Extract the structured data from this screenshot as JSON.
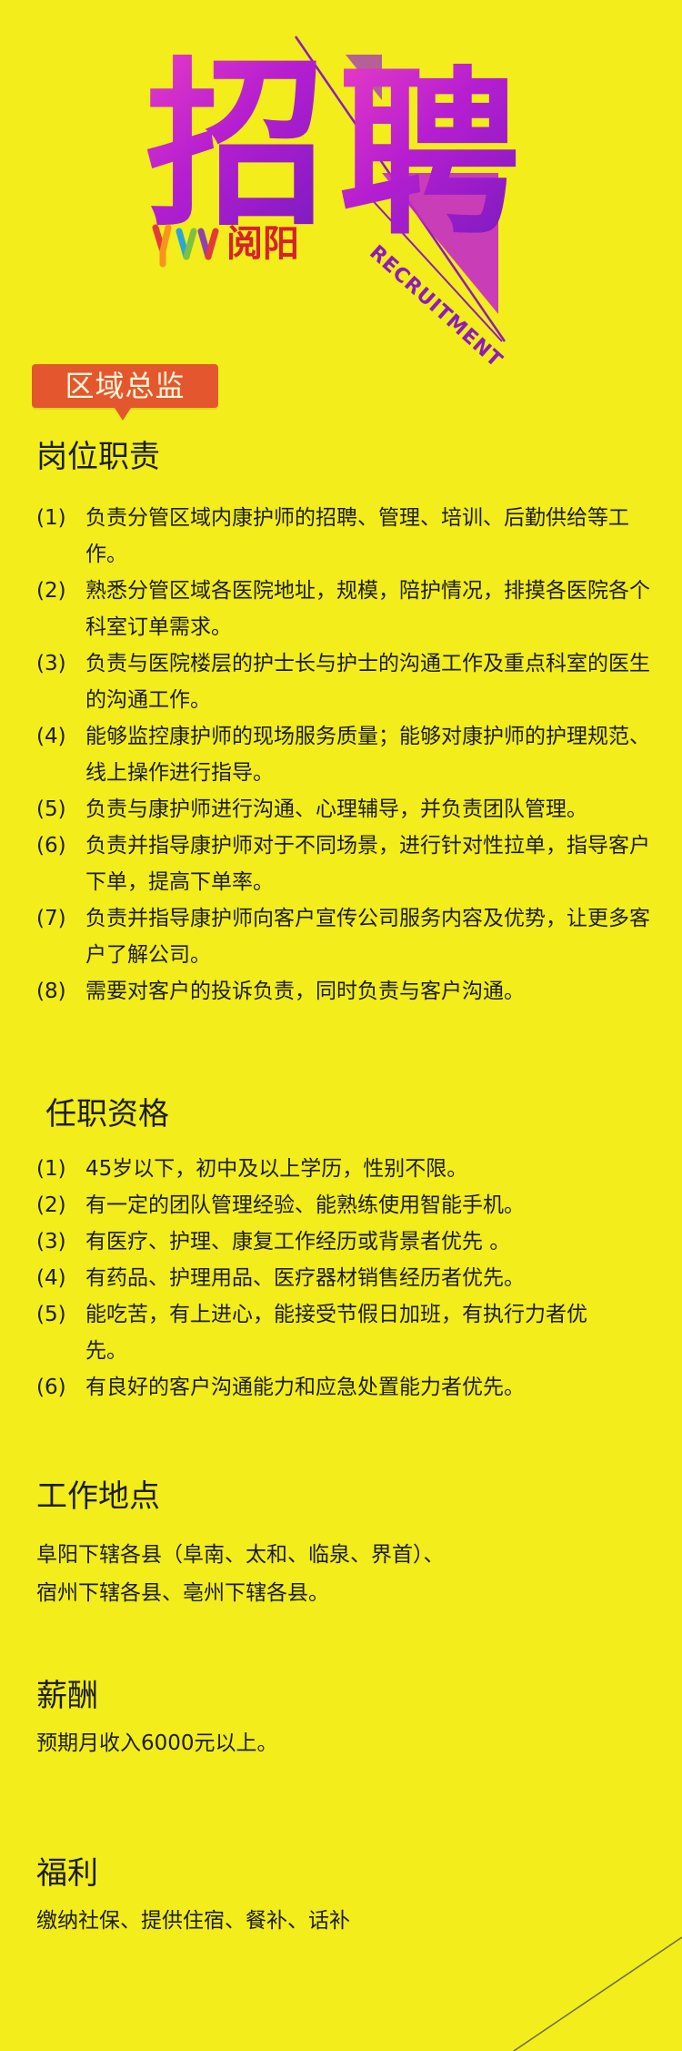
{
  "header": {
    "title_char_1": "招",
    "title_char_2": "聘",
    "recruitment_text": "RECRUITMENT",
    "logo_text": "阅阳",
    "logo_colors": [
      "#e53a3a",
      "#f7941e",
      "#2aa7d8",
      "#7cc242",
      "#8e44ad"
    ]
  },
  "badge": {
    "label": "区域总监",
    "color": "#e4572e"
  },
  "responsibilities": {
    "heading": "岗位职责",
    "items": [
      {
        "num": "(1)",
        "text": "负责分管区域内康护师的招聘、管理、培训、后勤供给等工作。"
      },
      {
        "num": "(2)",
        "text": "熟悉分管区域各医院地址，规模，陪护情况，排摸各医院各个科室订单需求。"
      },
      {
        "num": "(3)",
        "text": "负责与医院楼层的护士长与护士的沟通工作及重点科室的医生的沟通工作。"
      },
      {
        "num": "(4)",
        "text": "能够监控康护师的现场服务质量；能够对康护师的护理规范、线上操作进行指导。"
      },
      {
        "num": "(5)",
        "text": "负责与康护师进行沟通、心理辅导，并负责团队管理。"
      },
      {
        "num": "(6)",
        "text": "负责并指导康护师对于不同场景，进行针对性拉单，指导客户下单，提高下单率。"
      },
      {
        "num": "(7)",
        "text": "负责并指导康护师向客户宣传公司服务内容及优势，让更多客户了解公司。"
      },
      {
        "num": "(8)",
        "text": "需要对客户的投诉负责，同时负责与客户沟通。"
      }
    ]
  },
  "qualifications": {
    "heading": "任职资格",
    "items": [
      {
        "num": "(1)",
        "text": "45岁以下，初中及以上学历，性别不限。"
      },
      {
        "num": "(2)",
        "text": "有一定的团队管理经验、能熟练使用智能手机。"
      },
      {
        "num": "(3)",
        "text": "有医疗、护理、康复工作经历或背景者优先 。"
      },
      {
        "num": "(4)",
        "text": "有药品、护理用品、医疗器材销售经历者优先。"
      },
      {
        "num": "(5)",
        "text": "能吃苦，有上进心，能接受节假日加班，有执行力者优先。"
      },
      {
        "num": "(6)",
        "text": "有良好的客户沟通能力和应急处置能力者优先。"
      }
    ]
  },
  "location": {
    "heading": "工作地点",
    "line_1": "阜阳下辖各县（阜南、太和、临泉、界首）、",
    "line_2": "宿州下辖各县、亳州下辖各县。"
  },
  "salary": {
    "heading": "薪酬",
    "text": "预期月收入6000元以上。"
  },
  "benefits": {
    "heading": "福利",
    "text": "缴纳社保、提供住宿、餐补、话补"
  },
  "colors": {
    "background": "#f2ed1b",
    "title_gradient_start": "#e63ac6",
    "title_gradient_end": "#7a1bbf",
    "logo_text": "#d8222b"
  }
}
